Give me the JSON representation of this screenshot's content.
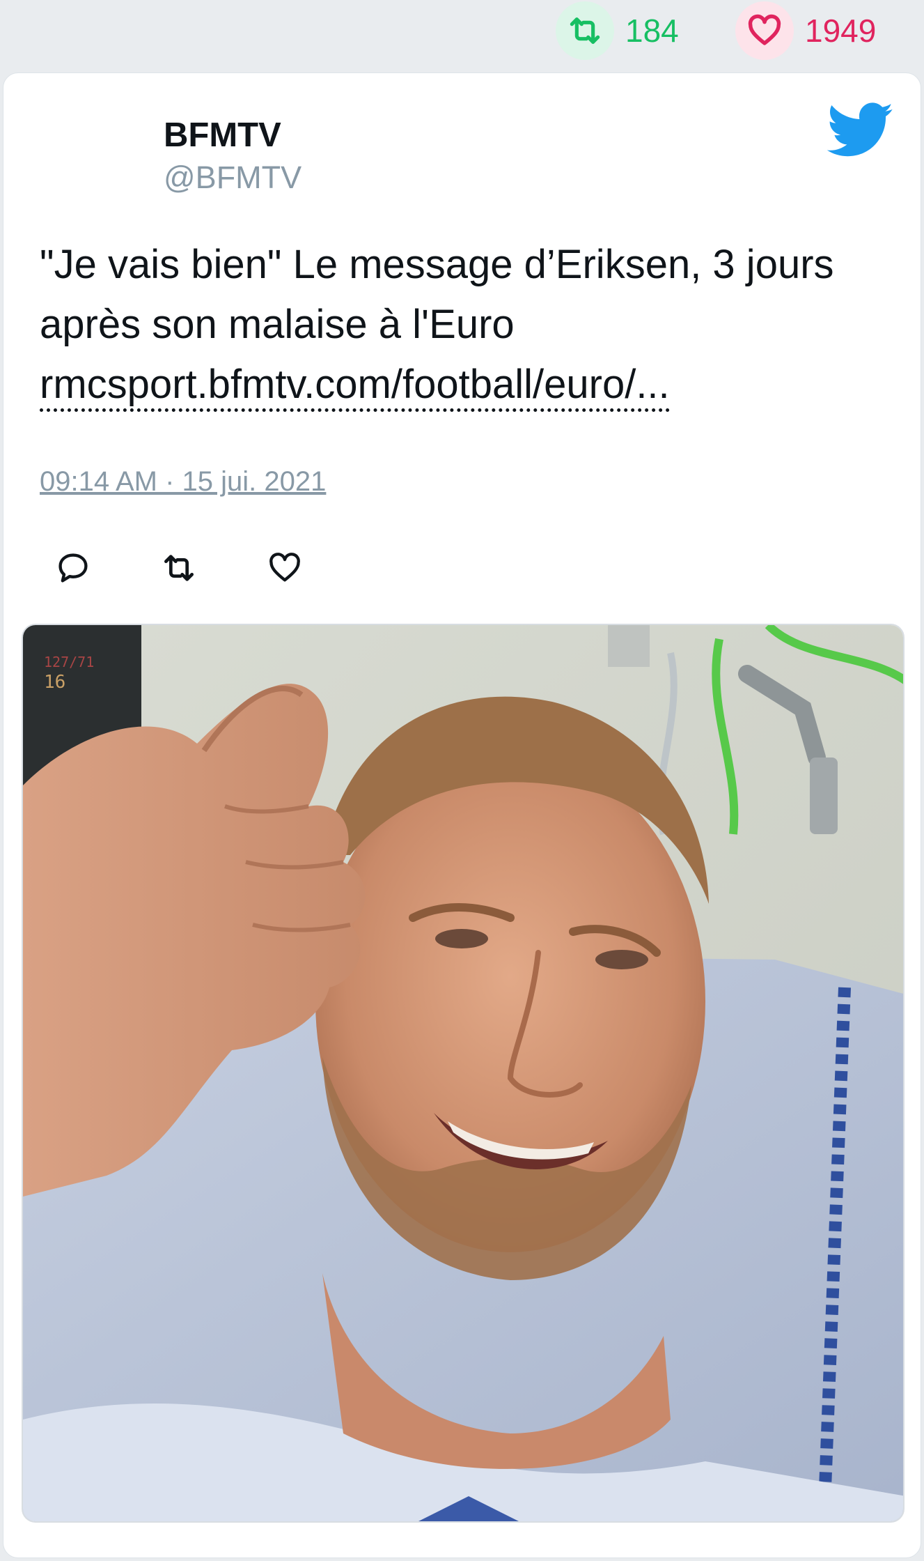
{
  "engagement": {
    "retweet_count": "184",
    "like_count": "1949",
    "retweet_color": "#17bf63",
    "like_color": "#e0245e"
  },
  "tweet": {
    "author_name": "BFMTV",
    "author_handle": "@BFMTV",
    "text": "\"Je vais bien\" Le message d’Eriksen, 3 jours après son malaise à l'Euro",
    "link_text": "rmcsport.bfmtv.com/football/euro/...",
    "timestamp": "09:14 AM · 15 jui. 2021"
  },
  "media": {
    "monitor_readout_top": "127/71",
    "monitor_readout_main": "16"
  },
  "icons": {
    "brand": "twitter-bird-icon",
    "actions": [
      "reply-icon",
      "retweet-icon",
      "like-icon"
    ]
  }
}
